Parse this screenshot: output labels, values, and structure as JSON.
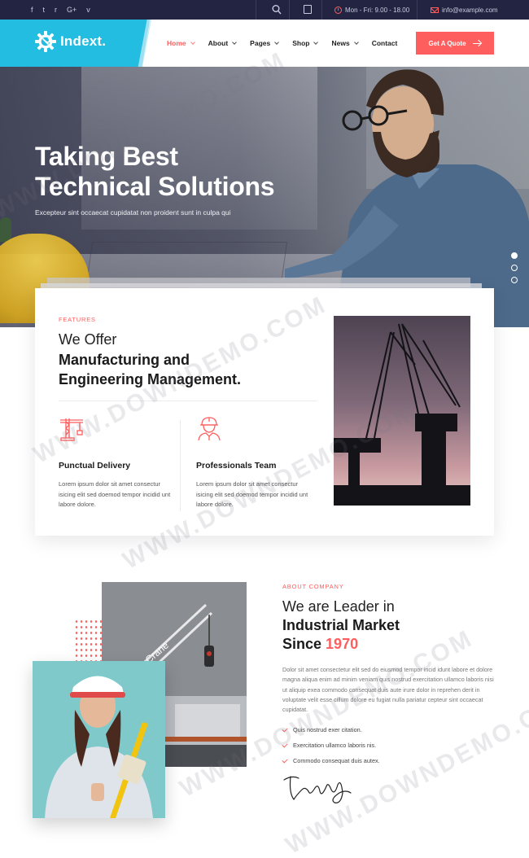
{
  "topbar": {
    "social_icons": [
      "facebook-icon",
      "twitter-icon",
      "rss-icon",
      "google-plus-icon",
      "vimeo-icon"
    ],
    "social_glyphs": [
      "f",
      "t",
      "r",
      "G+",
      "v"
    ],
    "hours": "Mon - Fri: 9.00 - 18.00",
    "email": "info@example.com"
  },
  "header": {
    "logo_text": "Indext.",
    "nav": [
      {
        "label": "Home",
        "dropdown": true,
        "active": true
      },
      {
        "label": "About",
        "dropdown": true,
        "active": false
      },
      {
        "label": "Pages",
        "dropdown": true,
        "active": false
      },
      {
        "label": "Shop",
        "dropdown": true,
        "active": false
      },
      {
        "label": "News",
        "dropdown": true,
        "active": false
      },
      {
        "label": "Contact",
        "dropdown": false,
        "active": false
      }
    ],
    "cta_label": "Get A Quote"
  },
  "hero": {
    "title_line1": "Taking Best",
    "title_line2": "Technical Solutions",
    "subtitle": "Excepteur sint occaecat cupidatat non proident sunt in culpa qui",
    "slides": 3,
    "active_slide": 1
  },
  "features": {
    "eyebrow": "FEATURES",
    "heading_light": "We Offer",
    "heading_bold_1": "Manufacturing and",
    "heading_bold_2": "Engineering Management.",
    "items": [
      {
        "icon": "crane-icon",
        "title": "Punctual Delivery",
        "desc": "Lorem ipsum dolor sit amet consectur isicing elit sed doemod tempor incidid unt labore dolore."
      },
      {
        "icon": "worker-icon",
        "title": "Professionals Team",
        "desc": "Lorem ipsum dolor sit amet consectur isicing elit sed doemod tempor incidid unt labore dolore."
      }
    ]
  },
  "about": {
    "eyebrow": "ABOUT COMPANY",
    "heading_light": "We are Leader in",
    "heading_bold_1": "Industrial Market",
    "heading_bold_2": "Since",
    "heading_year": "1970",
    "body": "Dolor sit amet consectetur elit sed do eiusmod tempor incid idunt labore et dolore magna aliqua enim ad minim veniam quis nostrud exercitation ullamco laboris nisi ut aliquip exea commodo consequat duis aute irure dolor in reprehen derit in voluptate velit esse cillum dolore eu fugiat nulla pariatur cepteur sint occaecat cupidatat.",
    "list": [
      "Quis nostrud exer citation.",
      "Exercitation ullamco laboris nis.",
      "Commodo consequat duis autex."
    ],
    "signature": "tenerity",
    "crane_label": "Crane"
  },
  "colors": {
    "accent": "#ff5e5e",
    "brand": "#22bde0",
    "topbar": "#232442"
  },
  "watermark": "WWW.DOWNDEMO.COM"
}
